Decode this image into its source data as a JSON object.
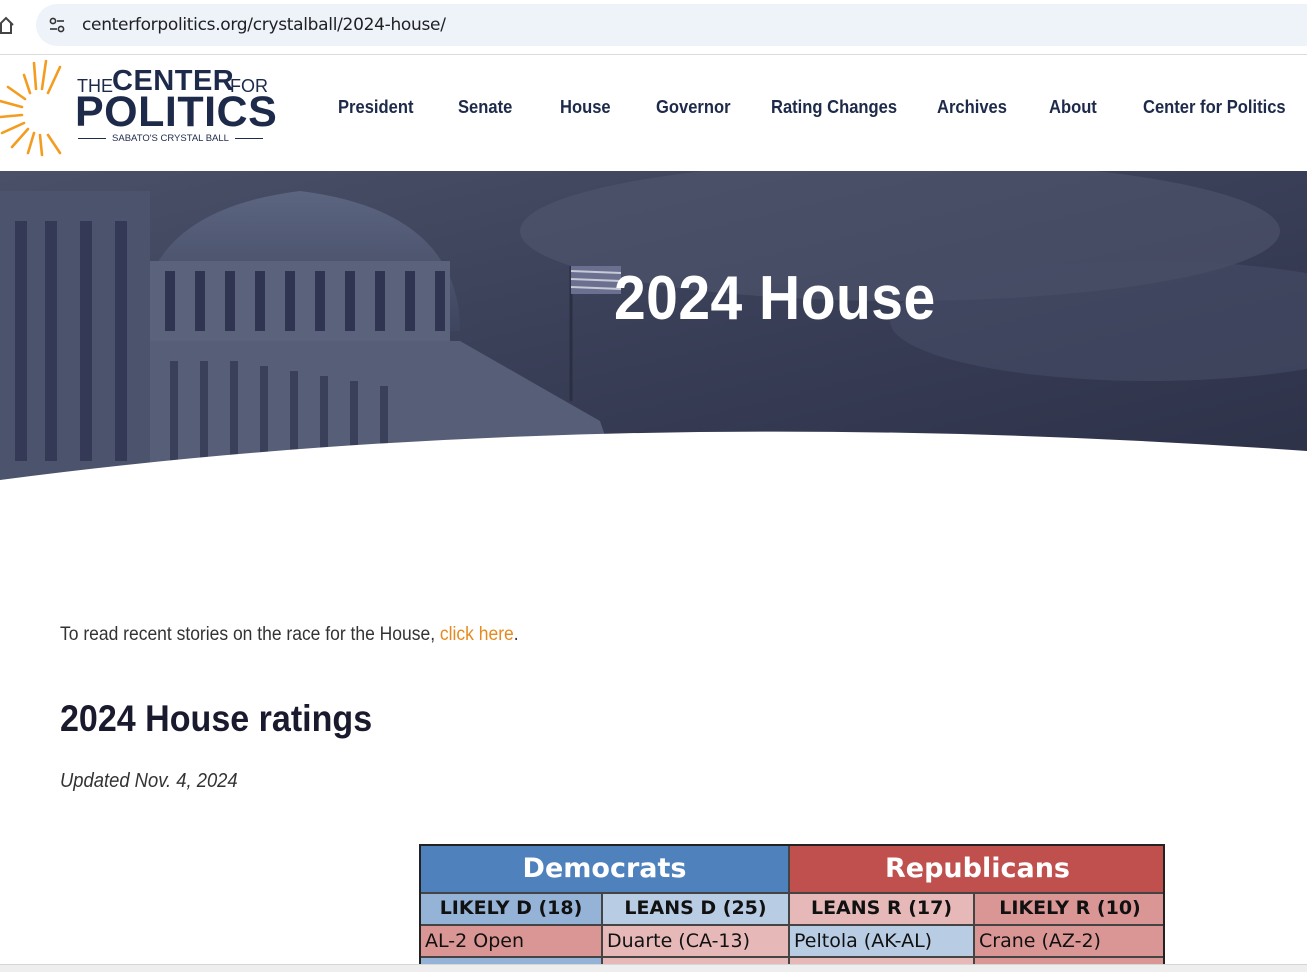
{
  "browser": {
    "url": "centerforpolitics.org/crystalball/2024-house/"
  },
  "logo": {
    "the": "THE",
    "center": "CENTER",
    "for": "FOR",
    "politics": "POLITICS",
    "tagline": "SABATO'S CRYSTAL BALL",
    "accent_color": "#f39c1f"
  },
  "nav": {
    "items": [
      {
        "label": "President"
      },
      {
        "label": "Senate"
      },
      {
        "label": "House"
      },
      {
        "label": "Governor"
      },
      {
        "label": "Rating Changes"
      },
      {
        "label": "Archives"
      },
      {
        "label": "About"
      },
      {
        "label": "Center for Politics"
      }
    ]
  },
  "hero": {
    "title": "2024 House"
  },
  "content": {
    "intro_text": "To read recent stories on the race for the House,",
    "intro_link": "click here",
    "intro_end": ".",
    "ratings_title": "2024 House ratings",
    "updated": "Updated Nov. 4, 2024",
    "link_color": "#e58a1f"
  },
  "table": {
    "democrats_label": "Democrats",
    "republicans_label": "Republicans",
    "columns": [
      {
        "label": "LIKELY D (18)",
        "first_race": "AL-2 Open"
      },
      {
        "label": "LEANS D (25)",
        "first_race": "Duarte (CA-13)"
      },
      {
        "label": "LEANS R (17)",
        "first_race": "Peltola (AK-AL)"
      },
      {
        "label": "LIKELY R (10)",
        "first_race": "Crane (AZ-2)"
      }
    ],
    "colors": {
      "dem_header": "#4f81bd",
      "rep_header": "#c0504d",
      "likely_d": "#95b3d7",
      "leans_d": "#b8cce4",
      "leans_r": "#e6b9b8",
      "likely_r": "#da9694"
    }
  }
}
